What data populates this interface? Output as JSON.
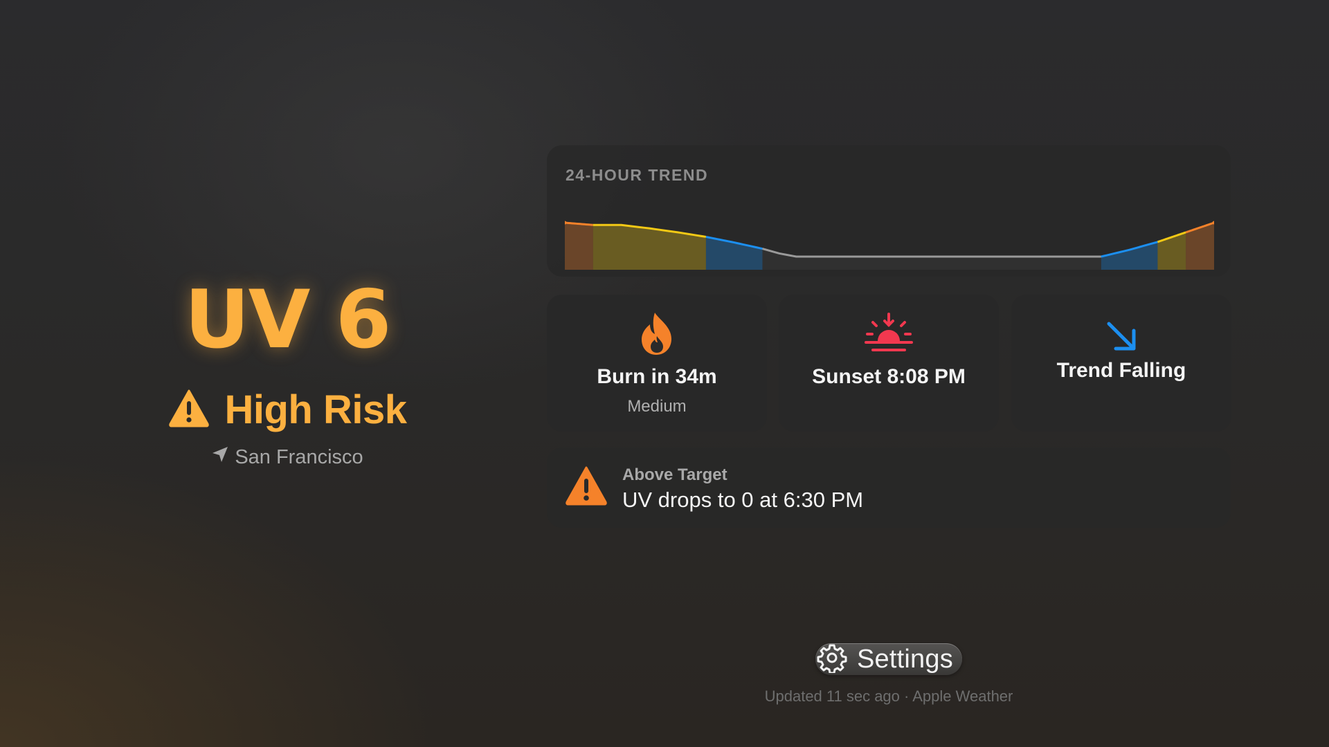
{
  "hero": {
    "uv_value": "UV 6",
    "risk_label": "High Risk",
    "location": "San Francisco",
    "accent_color": "#fcb040"
  },
  "trend": {
    "title": "24-HOUR TREND"
  },
  "chart_data": {
    "type": "area",
    "title": "24-HOUR TREND",
    "xlabel": "",
    "ylabel": "",
    "grid": false,
    "axes_visible": false,
    "ylim": [
      0,
      6
    ],
    "x": [
      0,
      1,
      2,
      3,
      4,
      5,
      6,
      7,
      8,
      9,
      10,
      11,
      12,
      13,
      14,
      15,
      16,
      17,
      18,
      19,
      20,
      21,
      22,
      23
    ],
    "values": [
      6,
      5.6,
      5.6,
      5,
      4.3,
      3.5,
      2.5,
      1.4,
      0,
      0,
      0,
      0,
      0,
      0,
      0,
      0,
      0,
      0,
      0,
      0,
      1.2,
      2.6,
      4.3,
      6
    ],
    "level_colors": {
      "high": "#f5822a",
      "moderate": "#f3c915",
      "low": "#1c8ff0",
      "none": "#9a9a9a"
    },
    "bands": [
      {
        "level": "high",
        "x_start": 0,
        "x_end": 1
      },
      {
        "level": "moderate",
        "x_start": 1,
        "x_end": 5
      },
      {
        "level": "low",
        "x_start": 5,
        "x_end": 7
      },
      {
        "level": "none",
        "x_start": 7,
        "x_end": 19
      },
      {
        "level": "low",
        "x_start": 19,
        "x_end": 21
      },
      {
        "level": "moderate",
        "x_start": 21,
        "x_end": 22
      },
      {
        "level": "high",
        "x_start": 22,
        "x_end": 23
      }
    ]
  },
  "stats": {
    "burn": {
      "label": "Burn in 34m",
      "sub": "Medium",
      "icon": "flame-icon",
      "color": "#f5822a"
    },
    "sunset": {
      "label": "Sunset 8:08 PM",
      "icon": "sunset-icon",
      "color": "#f2384f"
    },
    "trend": {
      "label": "Trend Falling",
      "icon": "arrow-down-right-icon",
      "color": "#1c8ff0"
    }
  },
  "alert": {
    "title": "Above Target",
    "text": "UV drops to 0 at 6:30 PM",
    "icon": "warning-icon",
    "color": "#f5822a"
  },
  "settings": {
    "label": "Settings",
    "icon": "gear-icon"
  },
  "footer": {
    "text": "Updated 11 sec ago · Apple Weather"
  }
}
